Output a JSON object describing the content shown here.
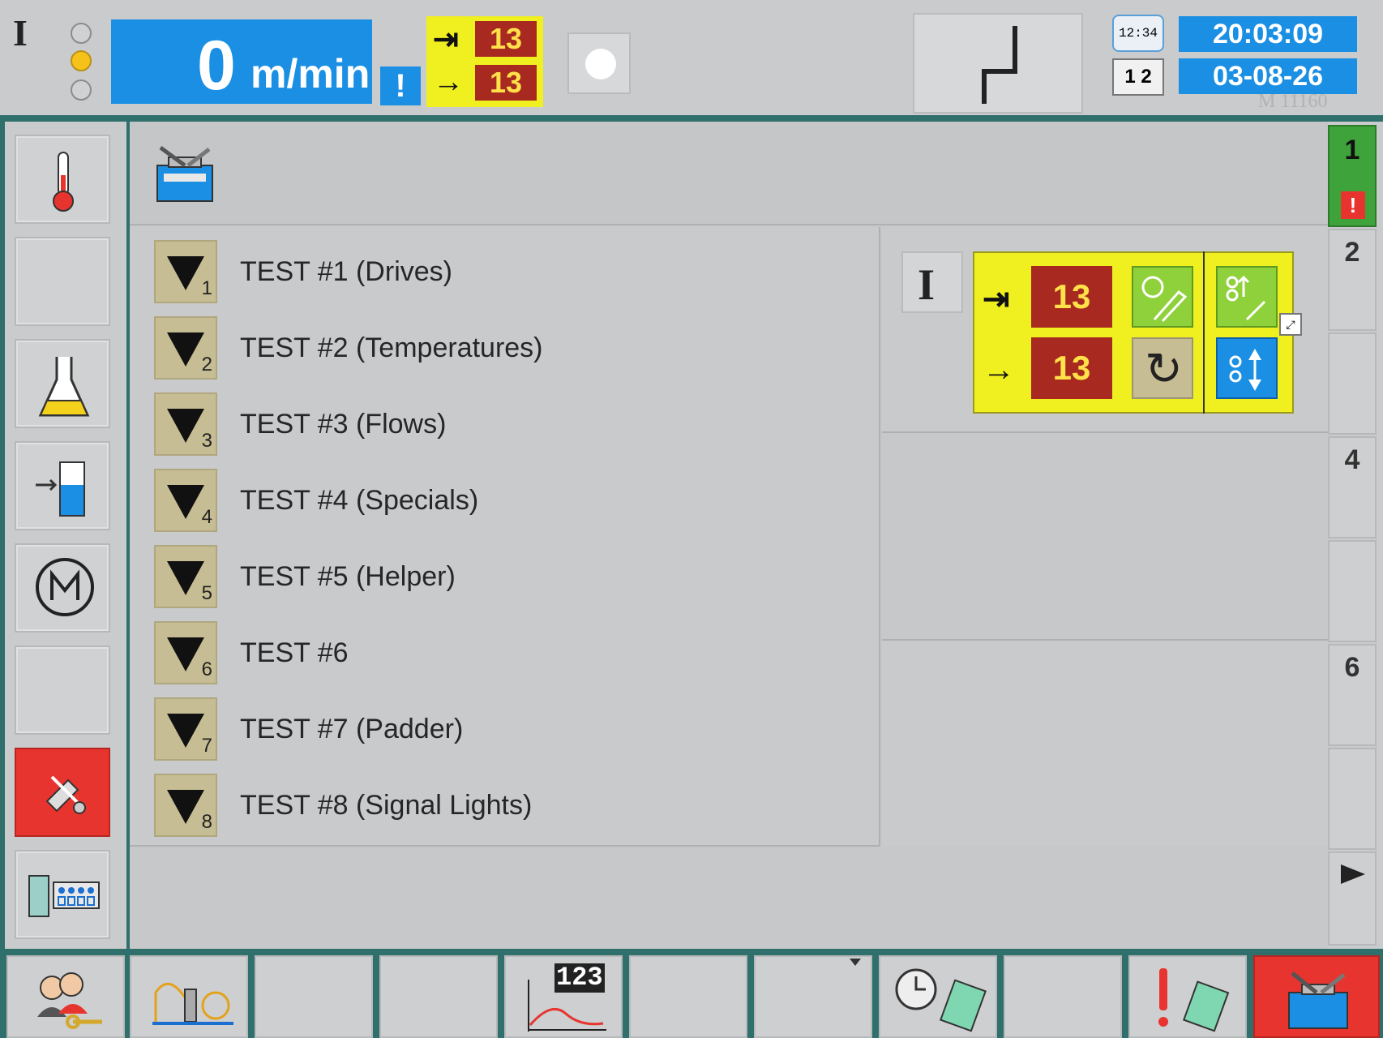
{
  "top_bar": {
    "mode_label": "I",
    "speed_value": "0",
    "speed_unit": "m/min",
    "speed_warning": "!",
    "counter_in": "13",
    "counter_out": "13",
    "clock_icon_text": "12:34",
    "page_icon_text": "1 2",
    "time": "20:03:09",
    "date": "03-08-26",
    "machine_id": "M 11160"
  },
  "tests": [
    {
      "label": "TEST #1 (Drives)",
      "num": "1"
    },
    {
      "label": "TEST #2 (Temperatures)",
      "num": "2"
    },
    {
      "label": "TEST #3 (Flows)",
      "num": "3"
    },
    {
      "label": "TEST #4 (Specials)",
      "num": "4"
    },
    {
      "label": "TEST #5 (Helper)",
      "num": "5"
    },
    {
      "label": "TEST #6",
      "num": "6"
    },
    {
      "label": "TEST #7 (Padder)",
      "num": "7"
    },
    {
      "label": "TEST #8 (Signal Lights)",
      "num": "8"
    }
  ],
  "control_panel": {
    "mode_label": "I",
    "counter_in": "13",
    "counter_out": "13"
  },
  "right_tabs": {
    "tab1": "1",
    "tab1_alert": "!",
    "tab2": "2",
    "tab4": "4",
    "tab6": "6"
  },
  "bottom_bar": {
    "counter_icon_text": "123"
  },
  "colors": {
    "frame": "#2f6f6c",
    "panel": "#c9cbcc",
    "blue": "#1a8fe3",
    "yellow": "#f0ef1f",
    "counter_red": "#a8291f",
    "active_red": "#e8342f",
    "tab_green": "#3fa33c",
    "test_button": "#c7bd94"
  }
}
